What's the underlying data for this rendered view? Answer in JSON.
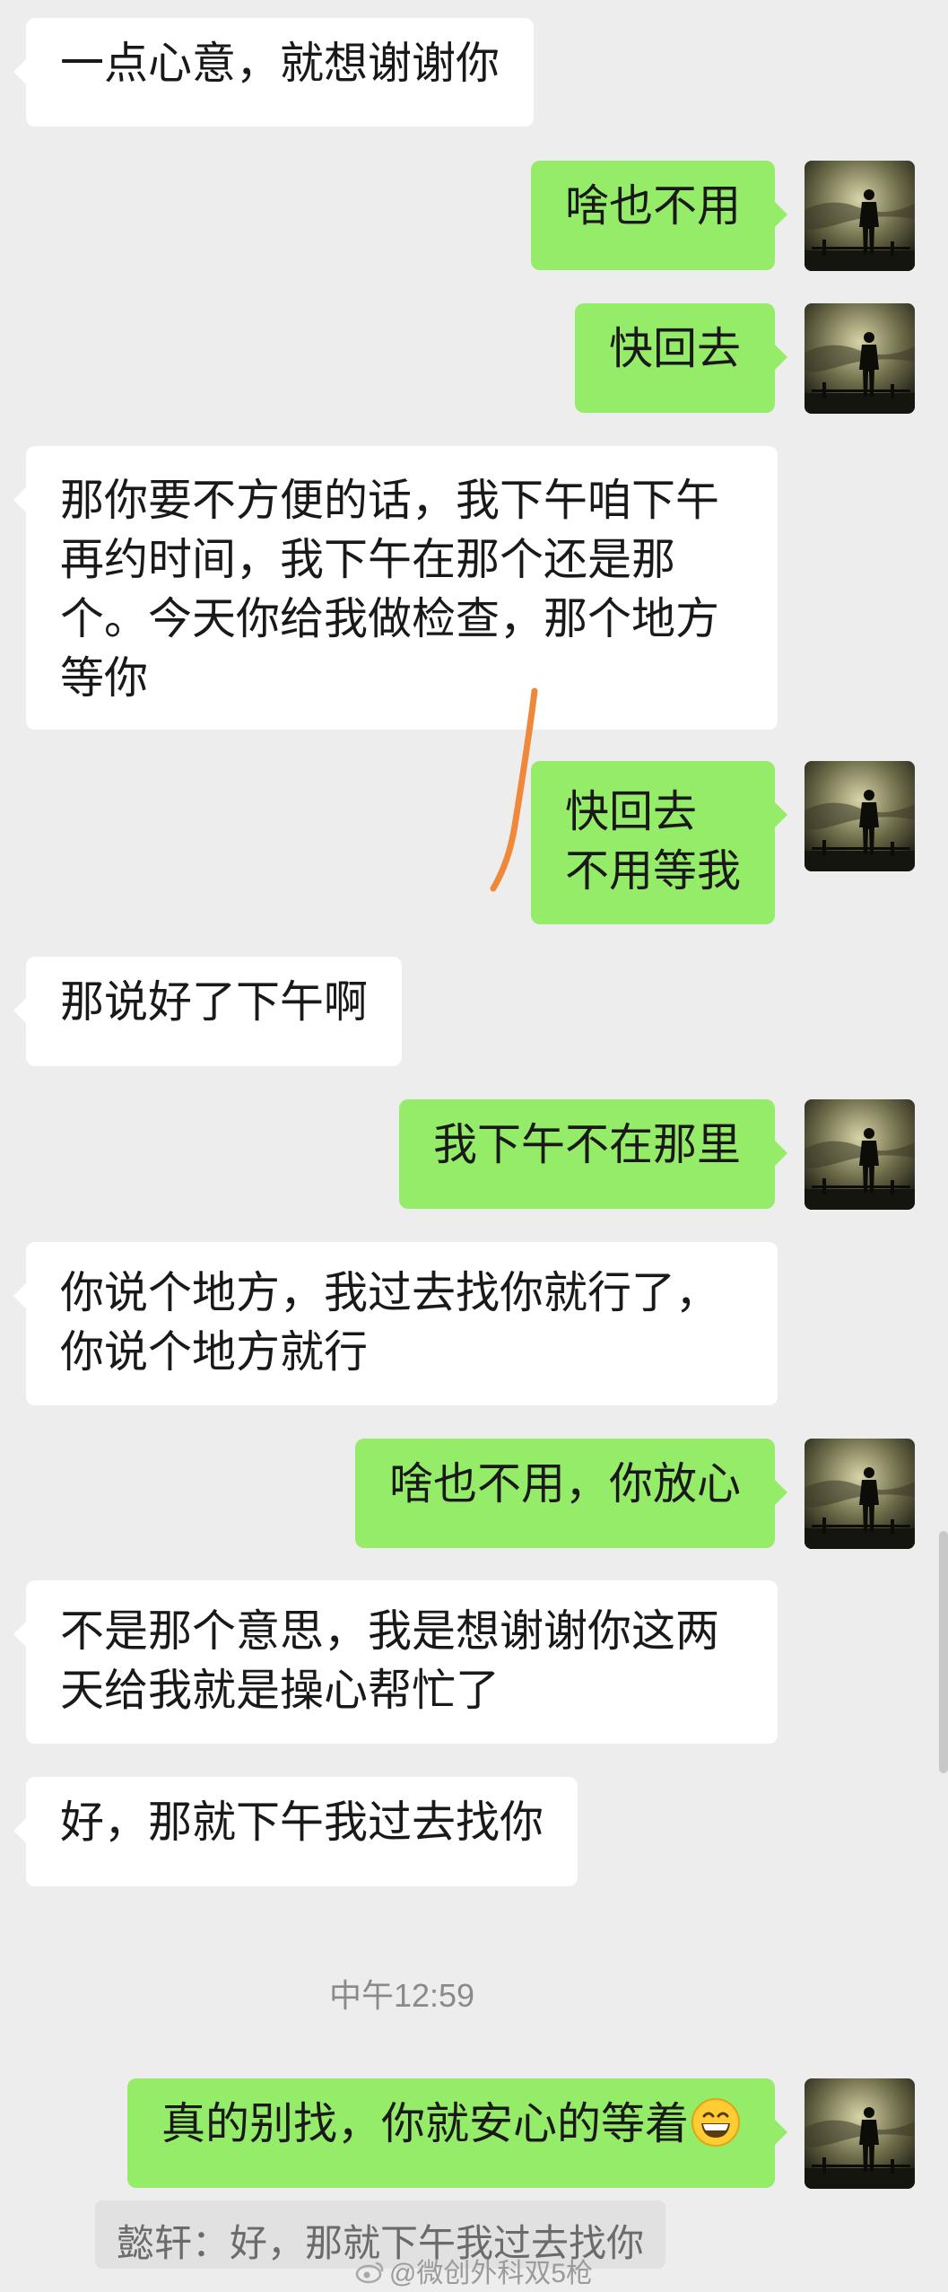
{
  "messages": [
    {
      "side": "left",
      "text": "一点心意，就想谢谢你"
    },
    {
      "side": "right",
      "text": "啥也不用"
    },
    {
      "side": "right",
      "text": "快回去"
    },
    {
      "side": "left",
      "text": "那你要不方便的话，我下午咱下午\n再约时间，我下午在那个还是那\n个。今天你给我做检查，那个地方\n等你"
    },
    {
      "side": "right",
      "text": "快回去\n不用等我"
    },
    {
      "side": "left",
      "text": "那说好了下午啊"
    },
    {
      "side": "right",
      "text": "我下午不在那里"
    },
    {
      "side": "left",
      "text": "你说个地方，我过去找你就行了，\n你说个地方就行"
    },
    {
      "side": "right",
      "text": "啥也不用，你放心"
    },
    {
      "side": "left",
      "text": "不是那个意思，我是想谢谢你这两\n天给我就是操心帮忙了"
    },
    {
      "side": "left",
      "text": "好，那就下午我过去找你"
    }
  ],
  "timestamp": "中午12:59",
  "last_message": {
    "side": "right",
    "text": "真的别找，你就安心的等着",
    "emoji": "grinning-face-icon"
  },
  "quote_reply": "懿轩：好，那就下午我过去找你",
  "watermark": "@微创外科双5枪",
  "colors": {
    "background": "#ededed",
    "bubble_self": "#95ec69",
    "bubble_other": "#ffffff",
    "annotation_stroke": "#f0883a"
  }
}
